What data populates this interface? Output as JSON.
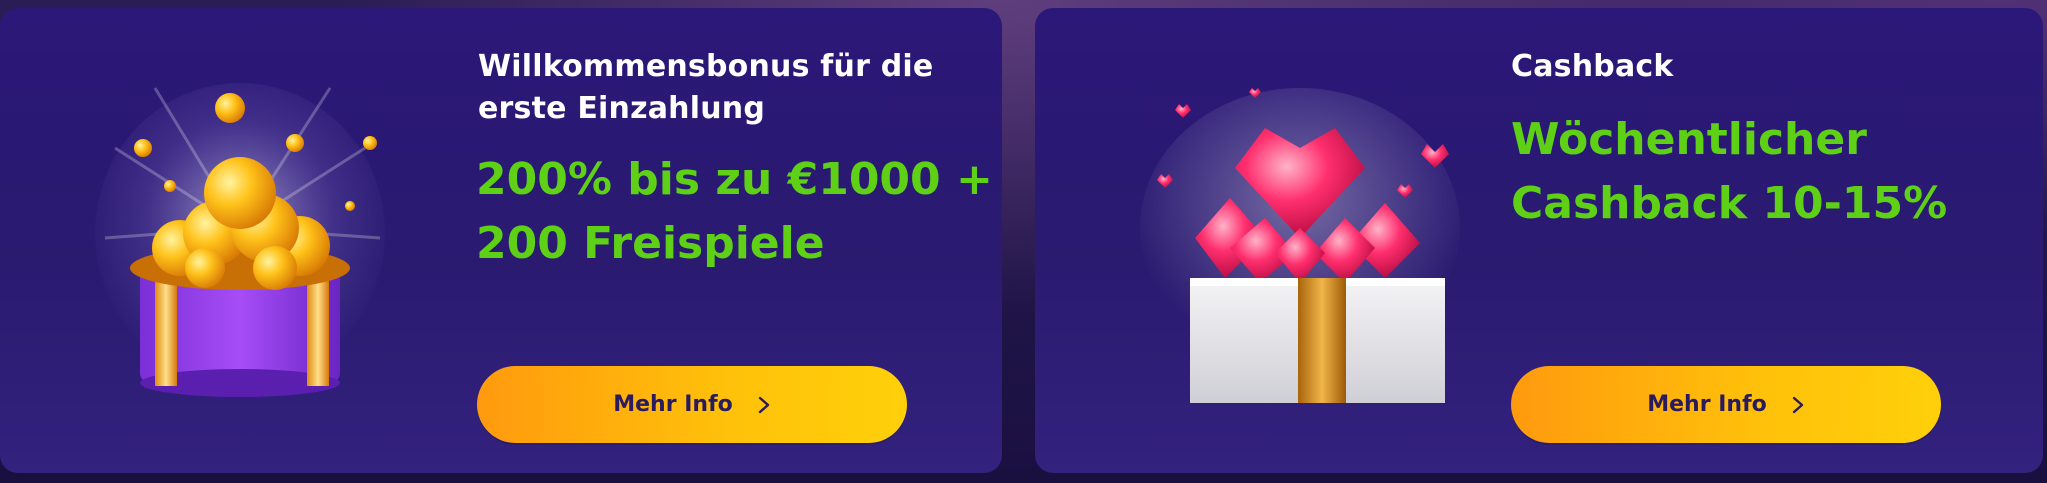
{
  "cards": [
    {
      "title": "Willkommensbonus für die erste Einzahlung",
      "highlight": "200% bis zu €1000 + 200 Freispiele",
      "button_label": "Mehr Info",
      "art_icon": "gift-box-gold-coins-icon"
    },
    {
      "title": "Cashback",
      "highlight": "Wöchentlicher Cashback 10-15%",
      "button_label": "Mehr Info",
      "art_icon": "gift-box-red-gems-icon"
    }
  ],
  "colors": {
    "card_bg": "#2b1878",
    "highlight_green": "#5ed117",
    "button_gradient_start": "#ff9a0e",
    "button_gradient_end": "#ffd00a",
    "button_text": "#2a1a5e"
  }
}
